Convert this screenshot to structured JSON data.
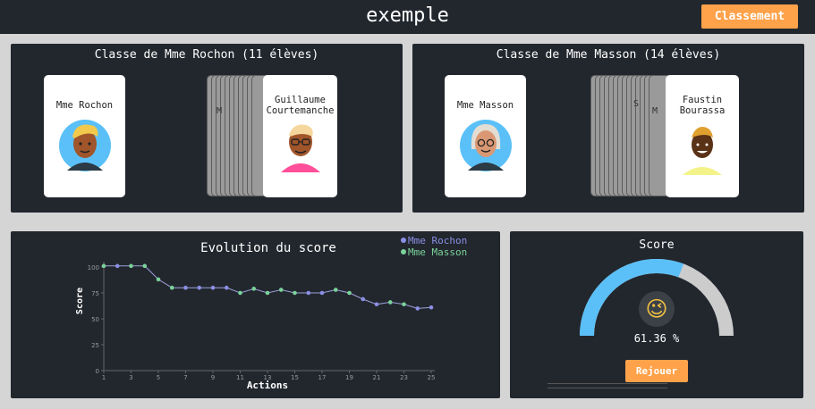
{
  "header": {
    "title": "exemple",
    "ranking_label": "Classement"
  },
  "classes": [
    {
      "title": "Classe de Mme Rochon (11 élèves)",
      "teacher": "Mme Rochon",
      "current_student": "Guillaume Courtemanche",
      "stack_hint": "M"
    },
    {
      "title": "Classe de Mme Masson (14 élèves)",
      "teacher": "Mme Masson",
      "current_student": "Faustin Bourassa",
      "stack_hint_1": "S",
      "stack_hint_2": "M"
    }
  ],
  "colors": {
    "series_rochon": "#8b8fe6",
    "series_masson": "#7bd39a",
    "gauge_fill": "#5bc0f8",
    "gauge_track": "#cccccc",
    "button": "#ffa24a",
    "panel": "#22272e"
  },
  "chart_data": {
    "type": "line",
    "title": "Evolution du score",
    "xlabel": "Actions",
    "ylabel": "Score",
    "xlim": [
      1,
      25
    ],
    "ylim": [
      0,
      100
    ],
    "x_ticks": [
      "1",
      "3",
      "5",
      "7",
      "9",
      "11",
      "13",
      "15",
      "17",
      "19",
      "21",
      "23",
      "25"
    ],
    "y_ticks": [
      "0",
      "25",
      "50",
      "75",
      "100"
    ],
    "legend": [
      {
        "name": "Mme Rochon",
        "color": "#8b8fe6"
      },
      {
        "name": "Mme Masson",
        "color": "#7bd39a"
      }
    ],
    "legend_position": "top-right",
    "points": [
      {
        "x": 1,
        "y": 101,
        "series": "Mme Masson"
      },
      {
        "x": 2,
        "y": 101,
        "series": "Mme Rochon"
      },
      {
        "x": 3,
        "y": 101,
        "series": "Mme Masson"
      },
      {
        "x": 4,
        "y": 101,
        "series": "Mme Masson"
      },
      {
        "x": 5,
        "y": 88,
        "series": "Mme Masson"
      },
      {
        "x": 6,
        "y": 80,
        "series": "Mme Masson"
      },
      {
        "x": 7,
        "y": 80,
        "series": "Mme Rochon"
      },
      {
        "x": 8,
        "y": 80,
        "series": "Mme Rochon"
      },
      {
        "x": 9,
        "y": 80,
        "series": "Mme Rochon"
      },
      {
        "x": 10,
        "y": 80,
        "series": "Mme Rochon"
      },
      {
        "x": 11,
        "y": 75,
        "series": "Mme Masson"
      },
      {
        "x": 12,
        "y": 79,
        "series": "Mme Masson"
      },
      {
        "x": 13,
        "y": 75,
        "series": "Mme Masson"
      },
      {
        "x": 14,
        "y": 78,
        "series": "Mme Masson"
      },
      {
        "x": 15,
        "y": 75,
        "series": "Mme Masson"
      },
      {
        "x": 16,
        "y": 75,
        "series": "Mme Rochon"
      },
      {
        "x": 17,
        "y": 75,
        "series": "Mme Rochon"
      },
      {
        "x": 18,
        "y": 78,
        "series": "Mme Masson"
      },
      {
        "x": 19,
        "y": 75,
        "series": "Mme Masson"
      },
      {
        "x": 20,
        "y": 69,
        "series": "Mme Rochon"
      },
      {
        "x": 21,
        "y": 64,
        "series": "Mme Rochon"
      },
      {
        "x": 22,
        "y": 66,
        "series": "Mme Masson"
      },
      {
        "x": 23,
        "y": 64,
        "series": "Mme Masson"
      },
      {
        "x": 24,
        "y": 60,
        "series": "Mme Rochon"
      },
      {
        "x": 25,
        "y": 61,
        "series": "Mme Rochon"
      }
    ]
  },
  "score": {
    "title": "Score",
    "value_percent": 61.36,
    "value_label": "61.36 %",
    "emoji": "😉",
    "replay_label": "Rejouer"
  }
}
